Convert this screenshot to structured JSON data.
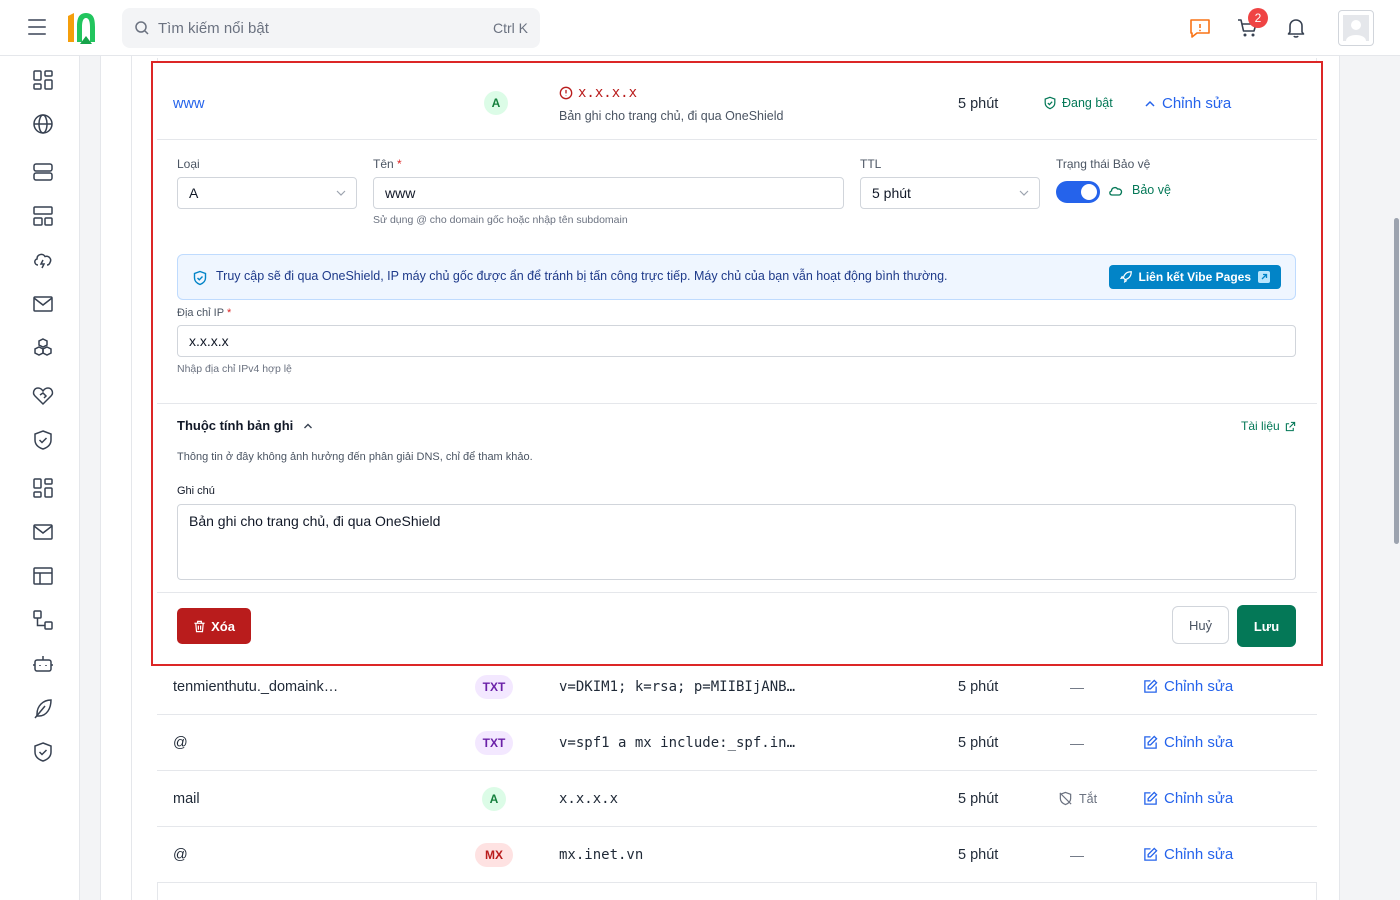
{
  "header": {
    "search_placeholder": "Tìm kiếm nổi bật",
    "search_shortcut": "Ctrl K",
    "cart_count": "2",
    "colors": {
      "brand_green": "#22c55e",
      "brand_orange": "#f59e0b"
    }
  },
  "sidebar": {
    "icons": [
      "dashboard-icon",
      "globe-icon",
      "server-icon",
      "hosting-icon",
      "cloud-lightning-icon",
      "mail-icon",
      "boxes-icon",
      "heart-handshake-icon",
      "shield-check-icon",
      "apps-icon",
      "mail-icon",
      "layout-icon",
      "workflow-icon",
      "bot-icon",
      "feather-icon",
      "shield-icon"
    ]
  },
  "expanded_record": {
    "name": "www",
    "type": "A",
    "value": "x.x.x.x",
    "note": "Bản ghi cho trang chủ, đi qua OneShield",
    "ttl": "5 phút",
    "status": "Đang bật",
    "edit_label": "Chỉnh sửa",
    "form": {
      "type_label": "Loại",
      "type_value": "A",
      "name_label": "Tên",
      "required_mark": "*",
      "name_value": "www",
      "name_hint": "Sử dụng @ cho domain gốc hoặc nhập tên subdomain",
      "ttl_label": "TTL",
      "ttl_value": "5 phút",
      "protect_label": "Trạng thái Bảo vệ",
      "protect_value": "Bảo vệ",
      "info_text": "Truy cập sẽ đi qua OneShield, IP máy chủ gốc được ẩn để tránh bị tấn công trực tiếp. Máy chủ của bạn vẫn hoạt động bình thường.",
      "vibe_button": "Liên kết Vibe Pages",
      "ip_label": "Địa chỉ IP",
      "ip_value": "x.x.x.x",
      "ip_hint": "Nhập địa chỉ IPv4 hợp lệ",
      "attributes_title": "Thuộc tính bản ghi",
      "docs_link": "Tài liệu",
      "attributes_desc": "Thông tin ở đây không ảnh hưởng đến phân giải DNS, chỉ để tham khảo.",
      "note_label": "Ghi chú",
      "note_value": "Bản ghi cho trang chủ, đi qua OneShield",
      "delete_button": "Xóa",
      "cancel_button": "Huỷ",
      "save_button": "Lưu"
    }
  },
  "records": [
    {
      "name": "tenmienthutu._domaink…",
      "type": "TXT",
      "value": "v=DKIM1; k=rsa; p=MIIBIjANB…",
      "ttl": "5 phút",
      "status": "—",
      "edit": "Chỉnh sửa"
    },
    {
      "name": "@",
      "type": "TXT",
      "value": "v=spf1 a mx include:_spf.in…",
      "ttl": "5 phút",
      "status": "—",
      "edit": "Chỉnh sửa"
    },
    {
      "name": "mail",
      "type": "A",
      "value": "x.x.x.x",
      "ttl": "5 phút",
      "status": "Tắt",
      "edit": "Chỉnh sửa"
    },
    {
      "name": "@",
      "type": "MX",
      "value": "mx.inet.vn",
      "ttl": "5 phút",
      "status": "—",
      "edit": "Chỉnh sửa"
    }
  ]
}
